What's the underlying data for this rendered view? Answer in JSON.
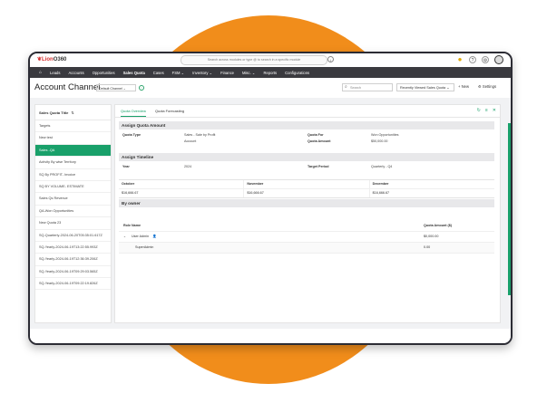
{
  "app": {
    "logo_brand": "Lion",
    "logo_suffix": "O360",
    "global_search_placeholder": "Search across modules or type @ to search in a specific module",
    "info_glyph": "i"
  },
  "nav": {
    "home_icon": "home-icon",
    "items": [
      "Leads",
      "Accounts",
      "Opportunities",
      "Sales Quota",
      "Cases",
      "FSM ⌄",
      "Inventory ⌄",
      "Finance",
      "Misc. ⌄",
      "Reports",
      "Configurations"
    ],
    "active_index": 3
  },
  "header": {
    "title": "Account Channel",
    "view_select": "Default Channel ⌄",
    "search_placeholder": "Search",
    "recent_select": "Recently Viewed Sales Quota ⌄",
    "new_label": "+ New",
    "settings_label": "⚙ Settings"
  },
  "sidebar": {
    "title": "Sales Quota Title",
    "sort_glyph": "⇅",
    "items": [
      "Targets",
      "New test",
      "Sales -QA",
      "Activity By wise Territory",
      "SQ By PROFIT- Invoice",
      "SQ BY VOLUME- ESTIMATE",
      "Sales Qs Revenue",
      "QA-Won Opportunities",
      "New Quota 23",
      "SQ-Quarterly-2024-06-20T05:35:01.617Z",
      "SQ-Yearly-2024-06-19T13:22:55.993Z",
      "SQ-Yearly-2024-06-19T12:36:39.206Z",
      "SQ-Yearly-2024-06-19T09:29:03.565Z",
      "SQ-Yearly-2024-06-19T09:22:19.826Z"
    ],
    "active_index": 2
  },
  "tabs": {
    "items": [
      "Quota Overview",
      "Quota Forecasting"
    ],
    "active_index": 0,
    "icons": [
      "refresh-icon",
      "list-icon",
      "close-icon"
    ]
  },
  "assign_quota": {
    "heading": "Assign Quota Amount",
    "quota_type_label": "Quota Type",
    "quota_type_value": "Sales - Sale by Profit",
    "quota_type_sub": "Account",
    "quota_for_label": "Quota For",
    "quota_for_value": "Won Opportunities",
    "quota_amount_label": "Quota Amount",
    "quota_amount_value": "$50,000.00"
  },
  "timeline": {
    "heading": "Assign Timeline",
    "year_label": "Year",
    "year_value": "2024",
    "target_period_label": "Target Period",
    "target_period_value": "Quarterly - Q4",
    "months": [
      "October",
      "November",
      "December"
    ],
    "amounts": [
      "$16,666.67",
      "$16,666.67",
      "$16,666.67"
    ]
  },
  "owners": {
    "heading": "By owner",
    "col_role": "Role Name",
    "col_amount": "Quota Amount ($)",
    "rows": [
      {
        "name": "User Admin",
        "amount": "$0,000.00"
      },
      {
        "name": "SuperAdmin",
        "amount": "0.00"
      }
    ]
  },
  "colors": {
    "accent": "#19a06a",
    "nav_bg": "#3a3a3f",
    "orb": "#f18d1b",
    "brand_red": "#d62f2f"
  }
}
